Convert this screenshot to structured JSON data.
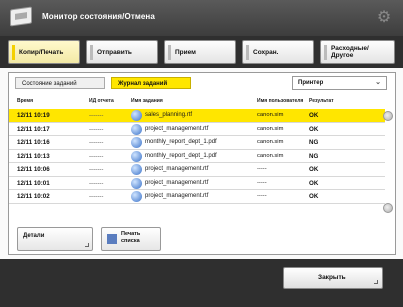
{
  "window": {
    "title": "Монитор состояния/Отмена"
  },
  "category_tabs": [
    {
      "label": "Копир/Печать",
      "active": true
    },
    {
      "label": "Отправить",
      "active": false
    },
    {
      "label": "Прием",
      "active": false
    },
    {
      "label": "Сохран.",
      "active": false
    },
    {
      "label": "Расходные/\nДругое",
      "active": false
    }
  ],
  "sub_tabs": [
    {
      "label": "Состояние заданий",
      "active": false
    },
    {
      "label": "Журнал заданий",
      "active": true
    }
  ],
  "filter": {
    "selected": "Принтер"
  },
  "columns": {
    "time": "Время",
    "id": "ИД отчета",
    "name": "Имя задания",
    "user": "Имя пользователя",
    "result": "Результат"
  },
  "rows": [
    {
      "time": "12/11 10:19",
      "id": "-------",
      "name": "sales_planning.rtf",
      "user": "canon.sim",
      "result": "OK",
      "selected": true
    },
    {
      "time": "12/11 10:17",
      "id": "-------",
      "name": "project_management.rtf",
      "user": "canon.sim",
      "result": "OK",
      "selected": false
    },
    {
      "time": "12/11 10:16",
      "id": "-------",
      "name": "monthly_report_dept_1.pdf",
      "user": "canon.sim",
      "result": "NG",
      "selected": false
    },
    {
      "time": "12/11 10:13",
      "id": "-------",
      "name": "monthly_report_dept_1.pdf",
      "user": "canon.sim",
      "result": "NG",
      "selected": false
    },
    {
      "time": "12/11 10:06",
      "id": "-------",
      "name": "project_management.rtf",
      "user": "-----",
      "result": "OK",
      "selected": false
    },
    {
      "time": "12/11 10:01",
      "id": "-------",
      "name": "project_management.rtf",
      "user": "-----",
      "result": "OK",
      "selected": false
    },
    {
      "time": "12/11 10:02",
      "id": "-------",
      "name": "project_management.rtf",
      "user": "-----",
      "result": "OK",
      "selected": false
    }
  ],
  "buttons": {
    "details": "Детали",
    "print_list": "Печать\nсписка",
    "close": "Закрыть"
  },
  "colors": {
    "accent": "#ffe600",
    "bar_dark": "#2f2f2f"
  }
}
